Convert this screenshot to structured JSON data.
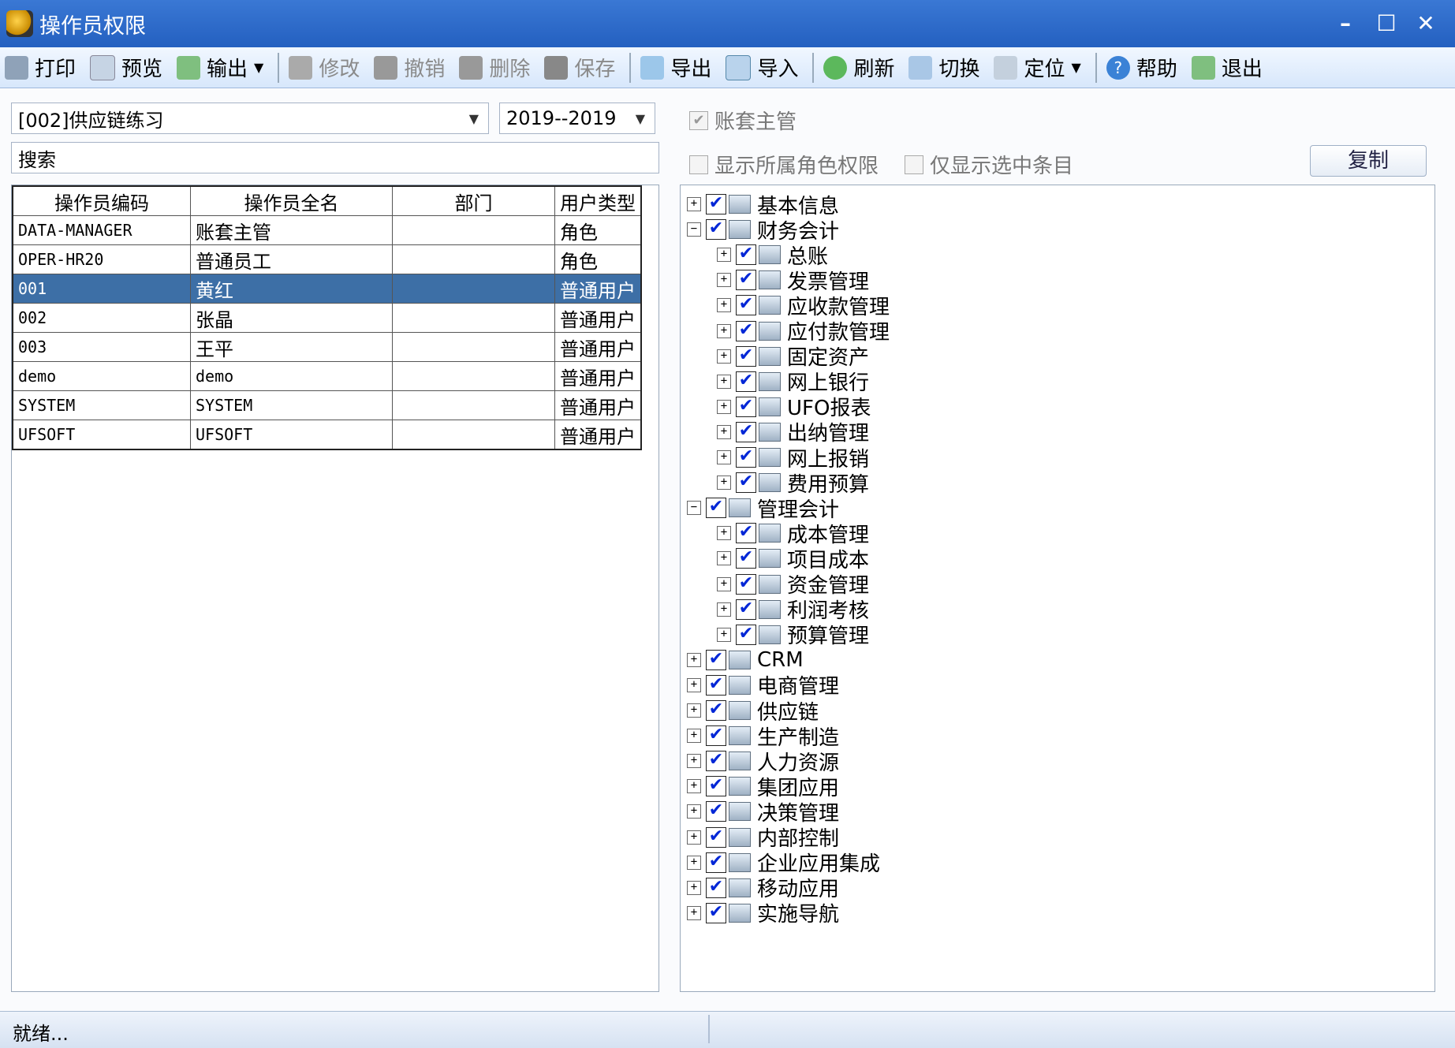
{
  "window": {
    "title": "操作员权限"
  },
  "toolbar": {
    "print": "打印",
    "preview": "预览",
    "output": "输出",
    "modify": "修改",
    "undo": "撤销",
    "delete": "删除",
    "save": "保存",
    "export": "导出",
    "import": "导入",
    "refresh": "刷新",
    "switch": "切换",
    "locate": "定位",
    "help": "帮助",
    "exit": "退出"
  },
  "filters": {
    "account_set": "[002]供应链练习",
    "year_range": "2019--2019",
    "search_label": "搜索"
  },
  "options": {
    "account_supervisor": "账套主管",
    "show_role_perms": "显示所属角色权限",
    "show_selected_only": "仅显示选中条目",
    "copy_button": "复制"
  },
  "table": {
    "columns": [
      "操作员编码",
      "操作员全名",
      "部门",
      "用户类型"
    ],
    "rows": [
      {
        "code": "DATA-MANAGER",
        "name": "账套主管",
        "dept": "",
        "type": "角色"
      },
      {
        "code": "OPER-HR20",
        "name": "普通员工",
        "dept": "",
        "type": "角色"
      },
      {
        "code": "001",
        "name": "黄红",
        "dept": "",
        "type": "普通用户"
      },
      {
        "code": "002",
        "name": "张晶",
        "dept": "",
        "type": "普通用户"
      },
      {
        "code": "003",
        "name": "王平",
        "dept": "",
        "type": "普通用户"
      },
      {
        "code": "demo",
        "name": "demo",
        "dept": "",
        "type": "普通用户"
      },
      {
        "code": "SYSTEM",
        "name": "SYSTEM",
        "dept": "",
        "type": "普通用户"
      },
      {
        "code": "UFSOFT",
        "name": "UFSOFT",
        "dept": "",
        "type": "普通用户"
      }
    ],
    "selected_index": 2
  },
  "tree": [
    {
      "label": "基本信息",
      "level": 0,
      "expander": "+"
    },
    {
      "label": "财务会计",
      "level": 0,
      "expander": "−"
    },
    {
      "label": "总账",
      "level": 1,
      "expander": "+"
    },
    {
      "label": "发票管理",
      "level": 1,
      "expander": "+"
    },
    {
      "label": "应收款管理",
      "level": 1,
      "expander": "+"
    },
    {
      "label": "应付款管理",
      "level": 1,
      "expander": "+"
    },
    {
      "label": "固定资产",
      "level": 1,
      "expander": "+"
    },
    {
      "label": "网上银行",
      "level": 1,
      "expander": "+"
    },
    {
      "label": "UFO报表",
      "level": 1,
      "expander": "+"
    },
    {
      "label": "出纳管理",
      "level": 1,
      "expander": "+"
    },
    {
      "label": "网上报销",
      "level": 1,
      "expander": "+"
    },
    {
      "label": "费用预算",
      "level": 1,
      "expander": "+"
    },
    {
      "label": "管理会计",
      "level": 0,
      "expander": "−"
    },
    {
      "label": "成本管理",
      "level": 1,
      "expander": "+"
    },
    {
      "label": "项目成本",
      "level": 1,
      "expander": "+"
    },
    {
      "label": "资金管理",
      "level": 1,
      "expander": "+"
    },
    {
      "label": "利润考核",
      "level": 1,
      "expander": "+"
    },
    {
      "label": "预算管理",
      "level": 1,
      "expander": "+"
    },
    {
      "label": "CRM",
      "level": 0,
      "expander": "+"
    },
    {
      "label": "电商管理",
      "level": 0,
      "expander": "+"
    },
    {
      "label": "供应链",
      "level": 0,
      "expander": "+"
    },
    {
      "label": "生产制造",
      "level": 0,
      "expander": "+"
    },
    {
      "label": "人力资源",
      "level": 0,
      "expander": "+"
    },
    {
      "label": "集团应用",
      "level": 0,
      "expander": "+"
    },
    {
      "label": "决策管理",
      "level": 0,
      "expander": "+"
    },
    {
      "label": "内部控制",
      "level": 0,
      "expander": "+"
    },
    {
      "label": "企业应用集成",
      "level": 0,
      "expander": "+"
    },
    {
      "label": "移动应用",
      "level": 0,
      "expander": "+"
    },
    {
      "label": "实施导航",
      "level": 0,
      "expander": "+"
    }
  ],
  "status": {
    "text": "就绪..."
  },
  "colors": {
    "title_bar": "#2f6dcc",
    "selection": "#3d6fa6",
    "check_mark": "#0026d6"
  }
}
